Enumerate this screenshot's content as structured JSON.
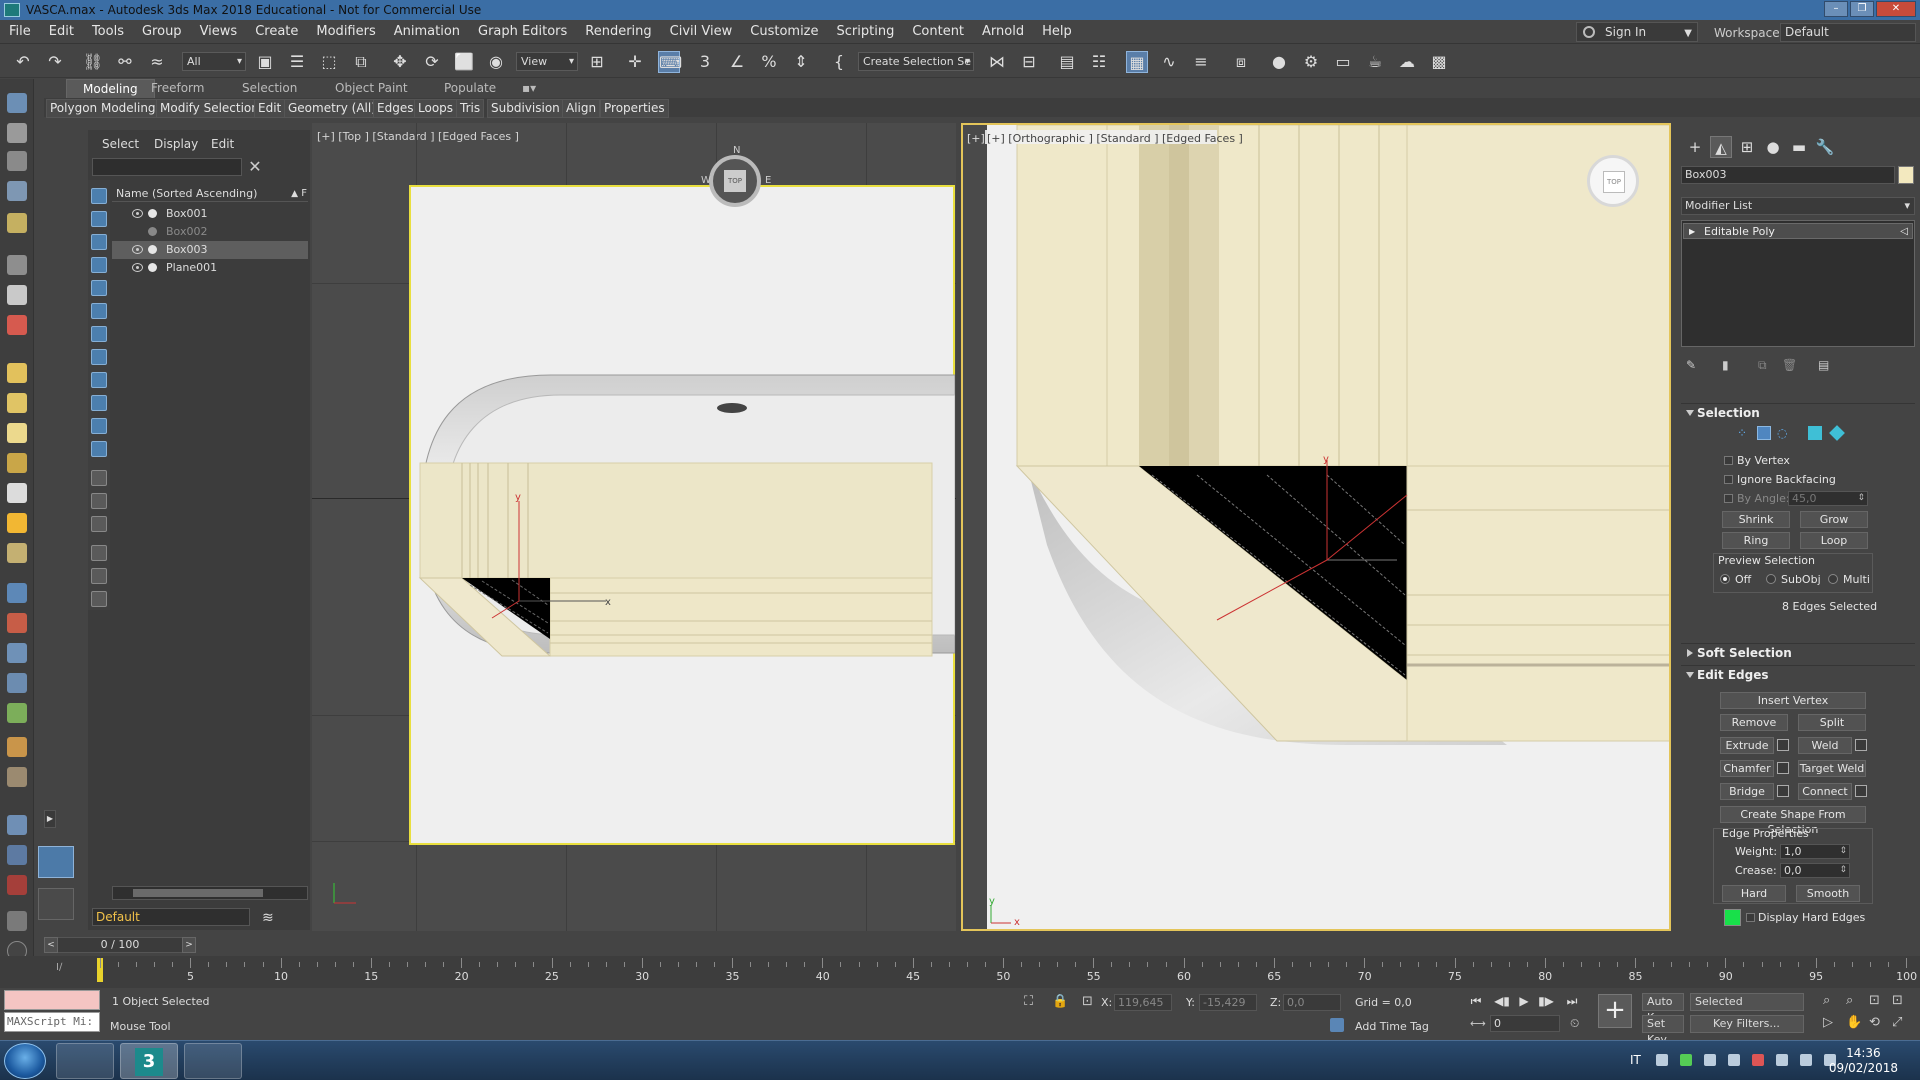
{
  "window": {
    "title": "VASCA.max - Autodesk 3ds Max 2018 Educational - Not for Commercial Use",
    "controls": [
      "–",
      "❐",
      "✕"
    ]
  },
  "menubar": {
    "items": [
      "File",
      "Edit",
      "Tools",
      "Group",
      "Views",
      "Create",
      "Modifiers",
      "Animation",
      "Graph Editors",
      "Rendering",
      "Civil View",
      "Customize",
      "Scripting",
      "Content",
      "Arnold",
      "Help"
    ],
    "sign_in": "Sign In",
    "workspaces_label": "Workspaces:",
    "workspaces_value": "Default"
  },
  "toolbar": {
    "filter_value": "All",
    "view_value": "View",
    "selection_set_value": "Create Selection Se"
  },
  "ribbon": {
    "tabs": [
      "Modeling",
      "Freeform",
      "Selection",
      "Object Paint",
      "Populate"
    ],
    "panels": [
      "Polygon Modeling",
      "Modify Selection",
      "Edit",
      "Geometry (All)",
      "Edges",
      "Loops",
      "Tris",
      "Subdivision",
      "Align",
      "Properties"
    ]
  },
  "explorer": {
    "tabs": [
      "Select",
      "Display",
      "Edit"
    ],
    "clear_icon": "✕",
    "header": "Name (Sorted Ascending)",
    "header_sort": "▲",
    "header_f": "F",
    "rows": [
      {
        "name": "Box001",
        "selected": false,
        "hidden": false
      },
      {
        "name": "Box002",
        "selected": false,
        "hidden": true
      },
      {
        "name": "Box003",
        "selected": true,
        "hidden": false
      },
      {
        "name": "Plane001",
        "selected": false,
        "hidden": false
      }
    ],
    "layer": "Default"
  },
  "viewports": {
    "top_label": "[+] [Top ] [Standard ] [Edged Faces ]",
    "ortho_label": "[+] [Orthographic ] [Standard ] [Edged Faces ]",
    "viewcube_top": "TOP",
    "compass": {
      "n": "N",
      "w": "W",
      "e": "E"
    },
    "axis_x": "x",
    "axis_y": "y"
  },
  "command_panel": {
    "object_name": "Box003",
    "object_color": "#f3e9bf",
    "modifier_list": "Modifier List",
    "stack_item": "Editable Poly",
    "selection": {
      "title": "Selection",
      "by_vertex": "By Vertex",
      "ignore_backfacing": "Ignore Backfacing",
      "by_angle": "By Angle:",
      "by_angle_value": "45,0",
      "shrink": "Shrink",
      "grow": "Grow",
      "ring": "Ring",
      "loop": "Loop",
      "preview_title": "Preview Selection",
      "preview_off": "Off",
      "preview_subobj": "SubObj",
      "preview_multi": "Multi",
      "status": "8 Edges Selected"
    },
    "soft_selection": "Soft Selection",
    "edit_edges": {
      "title": "Edit Edges",
      "insert_vertex": "Insert Vertex",
      "remove": "Remove",
      "split": "Split",
      "extrude": "Extrude",
      "weld": "Weld",
      "chamfer": "Chamfer",
      "target_weld": "Target Weld",
      "bridge": "Bridge",
      "connect": "Connect",
      "create_shape": "Create Shape From Selection",
      "edge_properties": "Edge Properties",
      "weight_label": "Weight:",
      "weight_value": "1,0",
      "crease_label": "Crease:",
      "crease_value": "0,0",
      "hard": "Hard",
      "smooth": "Smooth",
      "display_hard_edges": "Display Hard Edges",
      "hard_edge_color": "#18e04a"
    }
  },
  "timeline": {
    "frame": "0 / 100",
    "ticks": [
      "5",
      "10",
      "15",
      "20",
      "25",
      "30",
      "35",
      "40",
      "45",
      "50",
      "55",
      "60",
      "65",
      "70",
      "75",
      "80",
      "85",
      "90",
      "95",
      "100"
    ]
  },
  "status": {
    "maxscript": "MAXScript Mi:",
    "selected": "1 Object Selected",
    "prompt": "Mouse Tool",
    "x_label": "X:",
    "x_value": "119,645",
    "y_label": "Y:",
    "y_value": "-15,429",
    "z_label": "Z:",
    "z_value": "0,0",
    "grid": "Grid = 0,0",
    "add_time_tag": "Add Time Tag",
    "auto_key": "Auto Key",
    "selected_dropdown": "Selected",
    "set_key": "Set Key",
    "key_filters": "Key Filters...",
    "frame_field": "0"
  },
  "taskbar": {
    "lang": "IT",
    "time": "14:36",
    "date": "09/02/2018"
  }
}
